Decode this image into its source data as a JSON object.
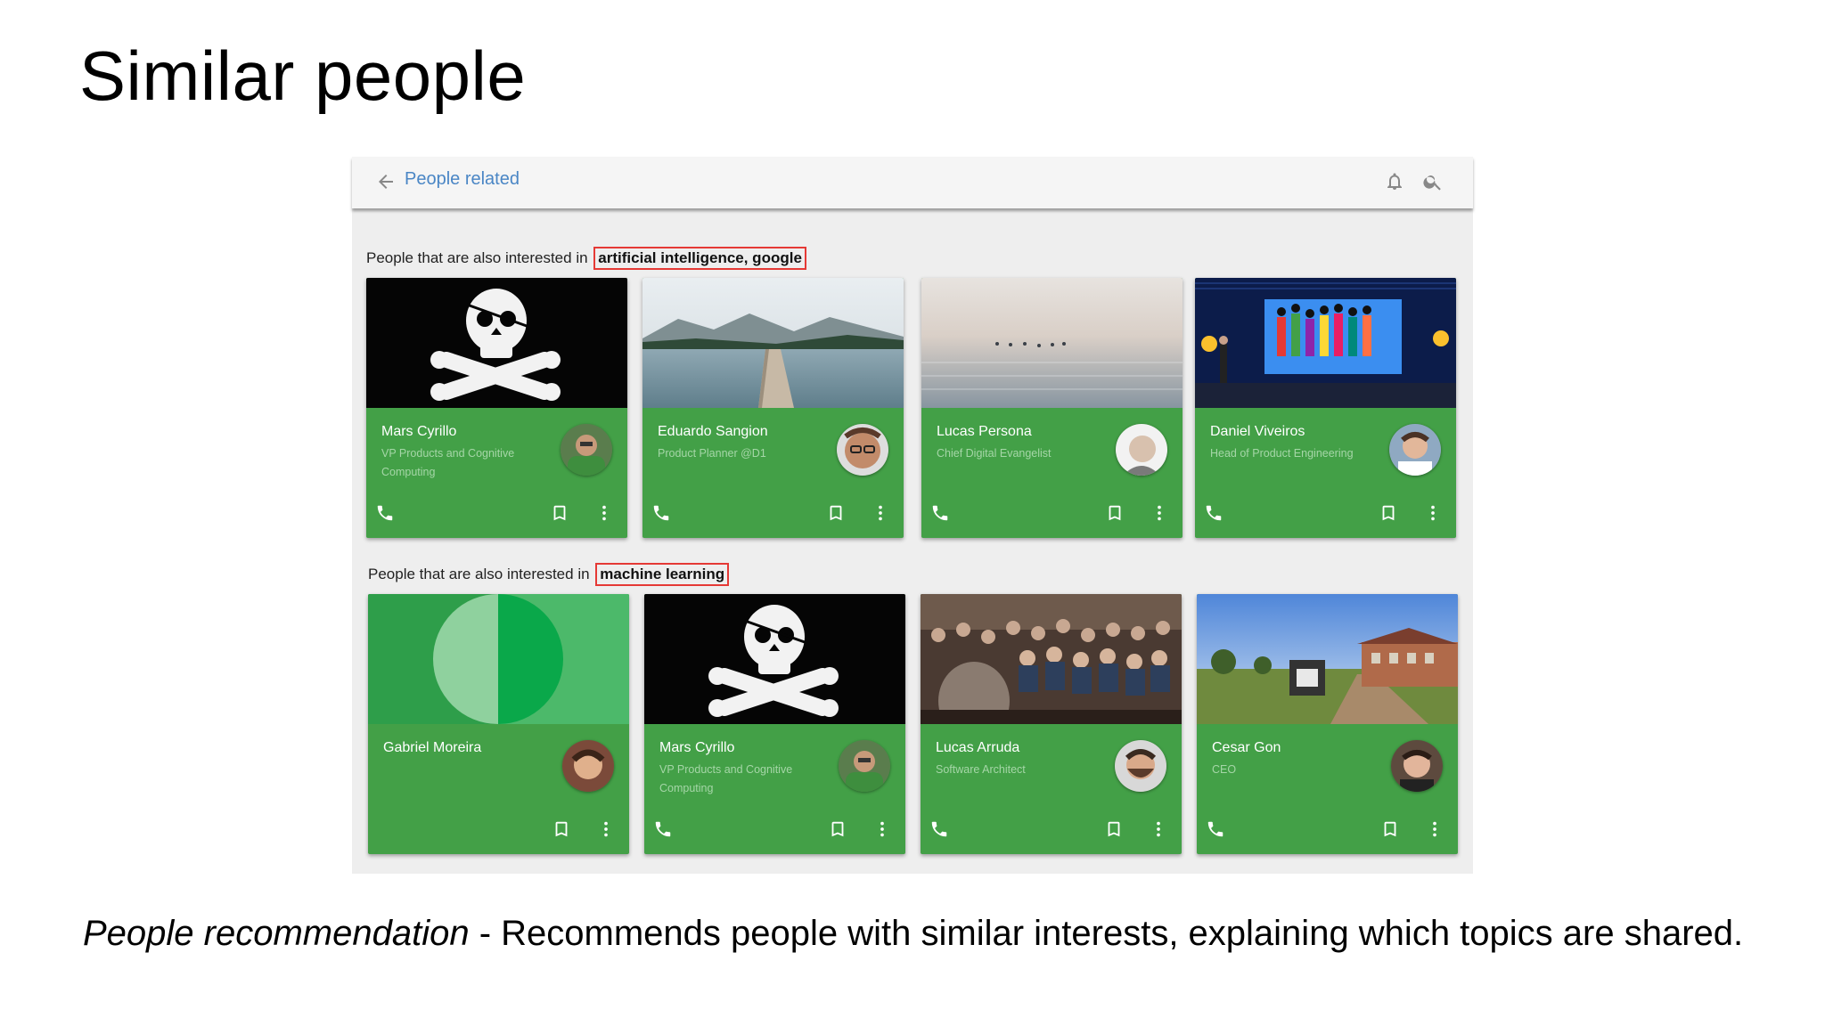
{
  "slide": {
    "title": "Similar people",
    "caption_italic": "People recommendation",
    "caption_rest": " - Recommends people with similar interests, explaining which topics are shared."
  },
  "appbar": {
    "title": "People related",
    "back_icon": "arrow-left-icon",
    "notifications_icon": "bell-icon",
    "search_icon": "search-icon",
    "accent": "#4a86c5"
  },
  "sections": [
    {
      "prefix": "People that are also interested in",
      "topics": "artificial intelligence, google",
      "cards": [
        {
          "name": "Mars Cyrillo",
          "role": "VP Products and Cognitive Computing",
          "cover": "pirate-flag",
          "phone": true
        },
        {
          "name": "Eduardo Sangion",
          "role": "Product Planner @D1",
          "cover": "lake-pier",
          "phone": true
        },
        {
          "name": "Lucas Persona",
          "role": "Chief Digital Evangelist",
          "cover": "sea",
          "phone": true
        },
        {
          "name": "Daniel Viveiros",
          "role": "Head of Product Engineering",
          "cover": "stage",
          "phone": true
        }
      ]
    },
    {
      "prefix": "People that are also interested in",
      "topics": "machine learning",
      "cards": [
        {
          "name": "Gabriel Moreira",
          "role": "",
          "cover": "green-circle",
          "phone": false
        },
        {
          "name": "Mars Cyrillo",
          "role": "VP Products and Cognitive Computing",
          "cover": "pirate-flag",
          "phone": true
        },
        {
          "name": "Lucas Arruda",
          "role": "Software Architect",
          "cover": "audience",
          "phone": true
        },
        {
          "name": "Cesar Gon",
          "role": "CEO",
          "cover": "campus",
          "phone": true
        }
      ]
    }
  ],
  "colors": {
    "card_green": "#43a047",
    "highlight_border": "#e53935"
  }
}
